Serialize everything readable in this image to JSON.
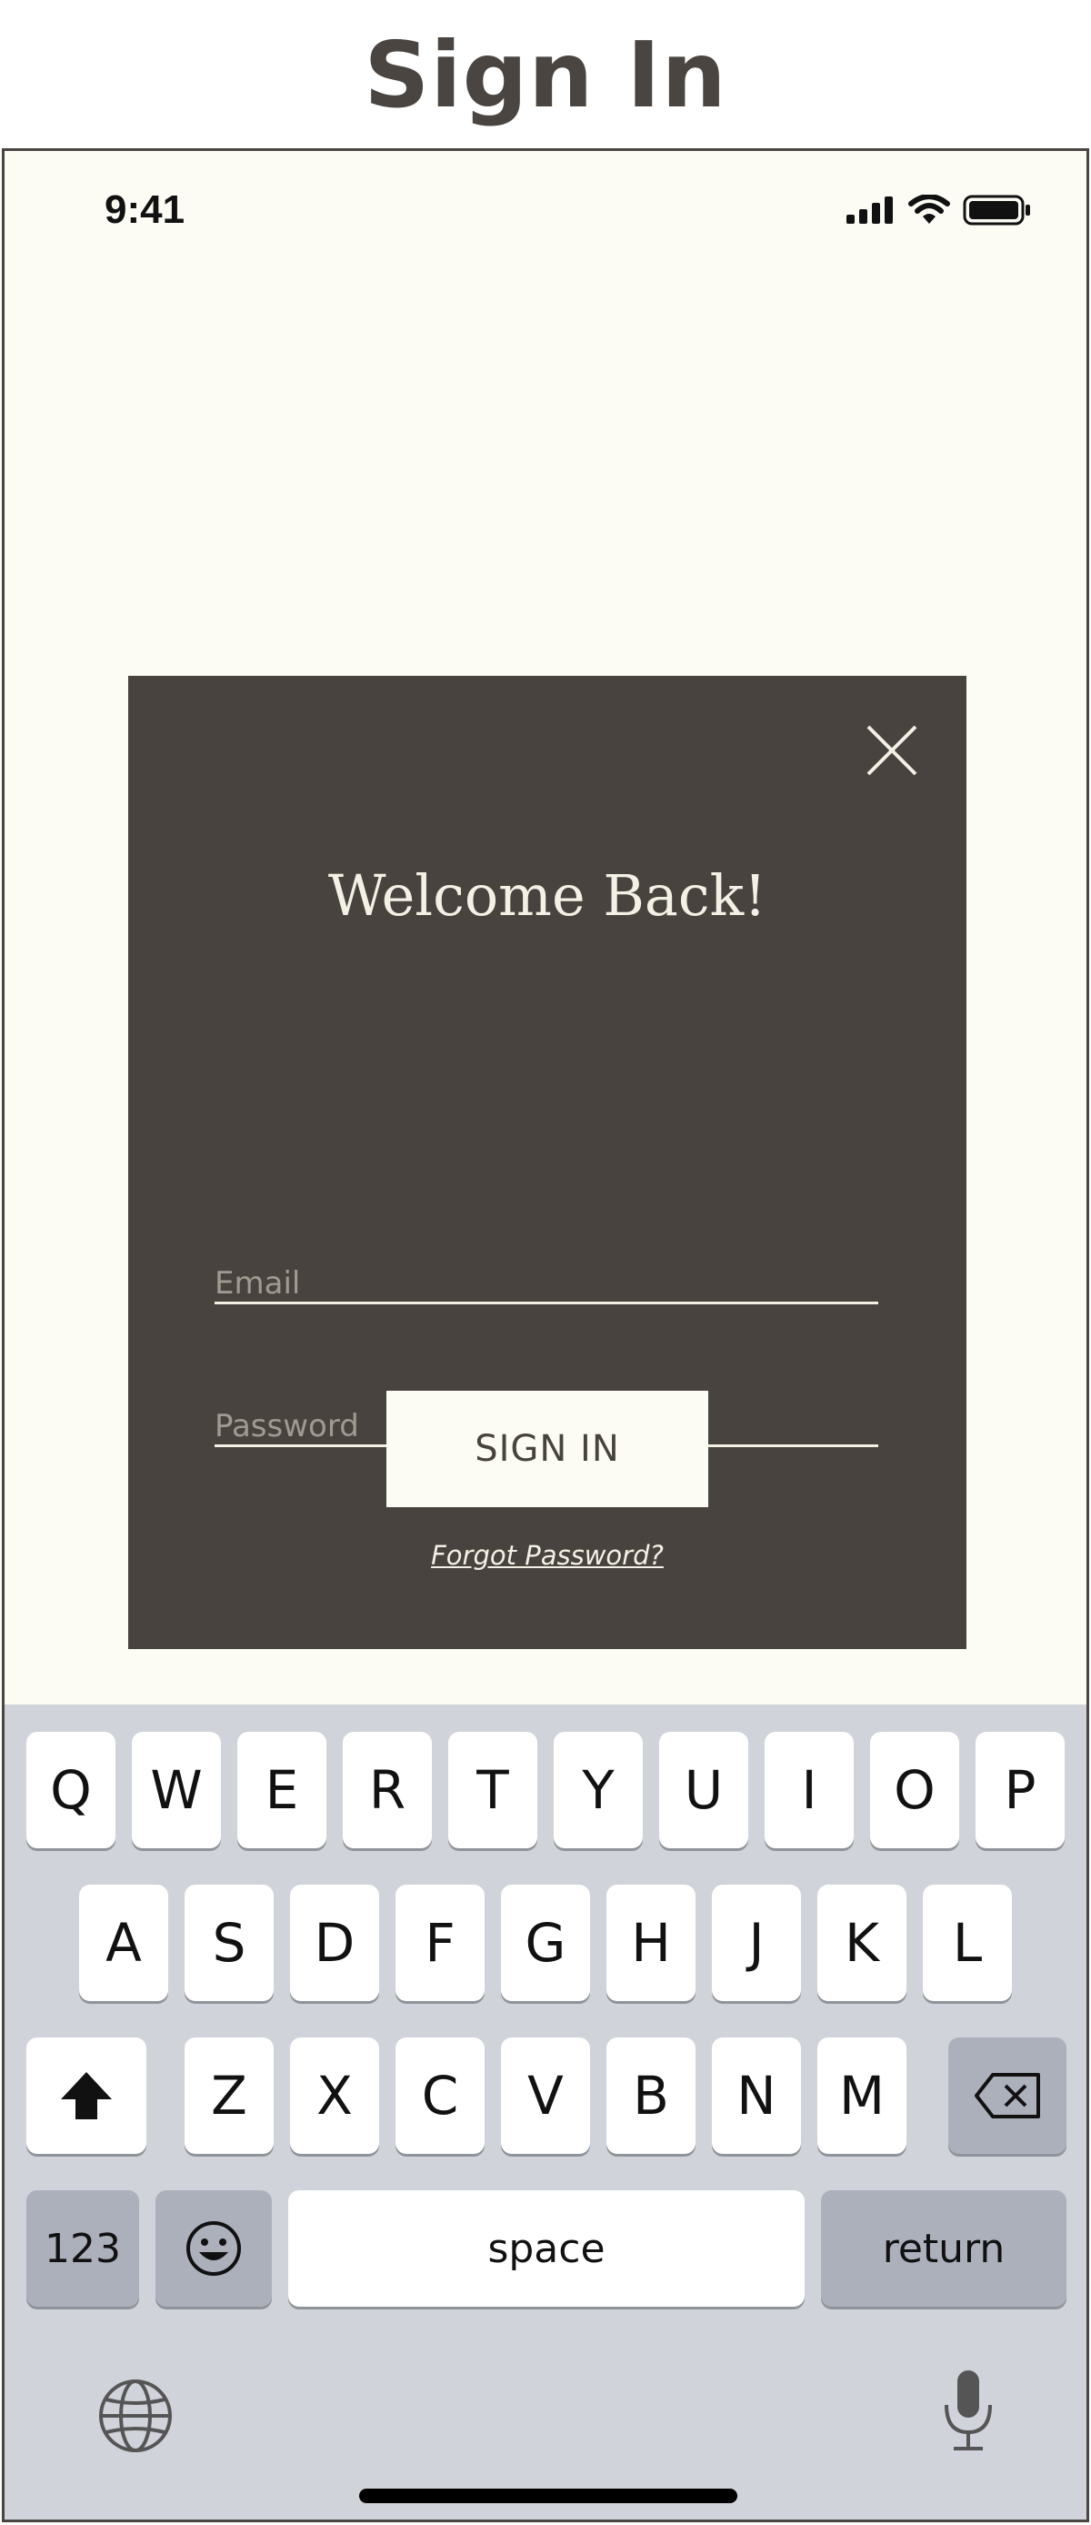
{
  "page": {
    "heading": "Sign In"
  },
  "status_bar": {
    "time": "9:41",
    "icons": [
      "signal-icon",
      "wifi-icon",
      "battery-icon"
    ]
  },
  "modal": {
    "close_icon": "close-icon",
    "title": "Welcome Back!",
    "email": {
      "placeholder": "Email",
      "value": ""
    },
    "password": {
      "placeholder": "Password",
      "value": ""
    },
    "signin_label": "SIGN IN",
    "forgot_label": "Forgot Password?"
  },
  "keyboard": {
    "row1": [
      "Q",
      "W",
      "E",
      "R",
      "T",
      "Y",
      "U",
      "I",
      "O",
      "P"
    ],
    "row2": [
      "A",
      "S",
      "D",
      "F",
      "G",
      "H",
      "J",
      "K",
      "L"
    ],
    "row3": [
      "Z",
      "X",
      "C",
      "V",
      "B",
      "N",
      "M"
    ],
    "numbers_label": "123",
    "space_label": "space",
    "return_label": "return",
    "icons": [
      "shift-icon",
      "backspace-icon",
      "emoji-icon",
      "globe-icon",
      "microphone-icon"
    ]
  },
  "colors": {
    "heading": "#4a4540",
    "modal_bg": "#48433e",
    "screen_bg": "#fcfcf4",
    "keyboard_bg": "#d0d3da",
    "key_dark": "#abb0bb"
  }
}
